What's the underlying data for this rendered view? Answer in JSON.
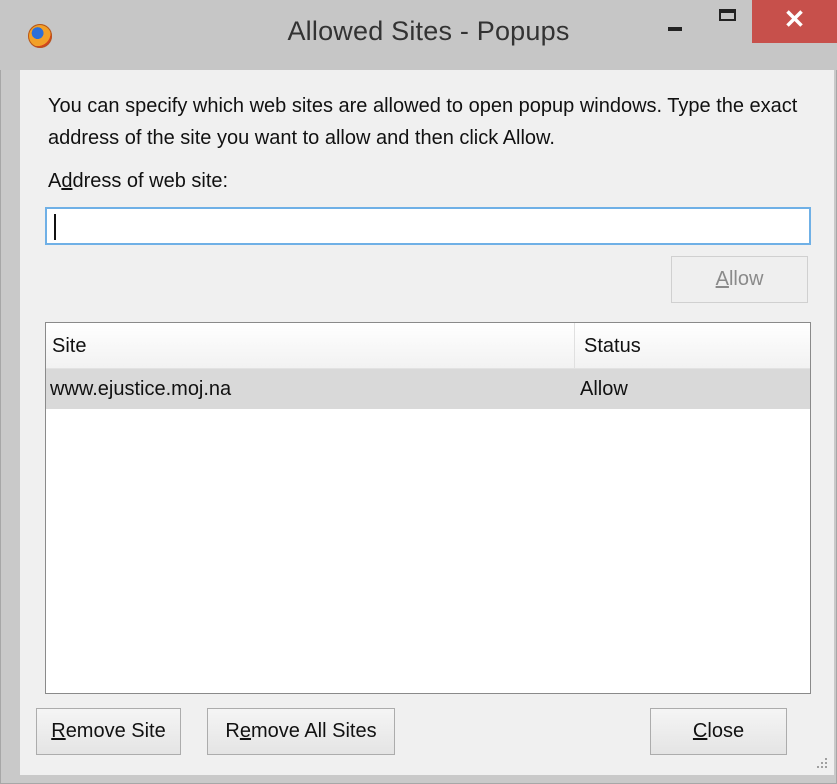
{
  "window": {
    "title": "Allowed Sites - Popups",
    "close_glyph": "✕"
  },
  "dialog": {
    "description": "You can specify which web sites are allowed to open popup windows. Type the exact address of the site you want to allow and then click Allow.",
    "address_label_pre": "A",
    "address_label_accel": "d",
    "address_label_post": "dress of web site:",
    "address_value": "",
    "allow_accel": "A",
    "allow_rest": "llow"
  },
  "list": {
    "columns": [
      "Site",
      "Status"
    ],
    "rows": [
      {
        "site": "www.ejustice.moj.na",
        "status": "Allow"
      }
    ]
  },
  "buttons": {
    "remove_site_accel": "R",
    "remove_site_rest": "emove Site",
    "remove_all_pre": "R",
    "remove_all_accel": "e",
    "remove_all_rest": "move All Sites",
    "close_accel": "C",
    "close_rest": "lose"
  },
  "colors": {
    "close_button": "#c7504b",
    "input_focus_border": "#6fb0e6",
    "selected_row": "#d9d9d9"
  }
}
